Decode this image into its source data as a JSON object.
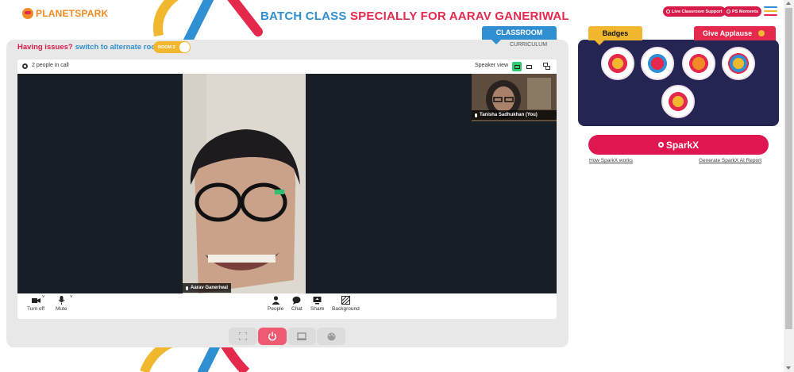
{
  "header": {
    "logo_text_a": "PLANET",
    "logo_text_b": "SPARK",
    "title_part1": "BATCH CLASS ",
    "title_part2": "SPECIALLY FOR AARAV GANERIWAL",
    "live_support_label": "Live Classroom Support",
    "moments_label": "PS Moments"
  },
  "left_panel": {
    "issues_question": "Having issues?",
    "switch_label": "switch to alternate room",
    "room_toggle_label": "ROOM 2",
    "classroom_tab": "CLASSROOM",
    "curriculum_tab": "CURRICULUM"
  },
  "video_call": {
    "people_count": "2 people in call",
    "speaker_view_label": "Speaker view",
    "main_participant": "Aarav Ganeriwal",
    "self_participant": "Tanisha Sadhukhan (You)",
    "controls": {
      "camera": "Turn off",
      "mic": "Mute",
      "people": "People",
      "chat": "Chat",
      "share": "Share",
      "background": "Background"
    }
  },
  "right_panel": {
    "badges_tab": "Badges",
    "applause_tab": "Give Applause",
    "sparkx_button": "SparkX",
    "how_sparkx_link": "How SparkX works",
    "generate_report_link": "Generate SparkX AI Report"
  },
  "colors": {
    "brand_red": "#e5294c",
    "brand_blue": "#2f8fd0",
    "brand_yellow": "#f0b72f",
    "badge_panel_bg": "#252553",
    "sparkx_red": "#e01650"
  },
  "icons": {
    "gear": "gear-icon",
    "camera": "camera-icon",
    "mic": "mic-icon",
    "people": "people-icon",
    "chat": "chat-icon",
    "share": "share-icon",
    "background": "background-icon",
    "fullscreen": "fullscreen-icon",
    "power": "power-icon",
    "screen": "screen-icon",
    "palette": "palette-icon",
    "menu": "hamburger-menu-icon"
  }
}
